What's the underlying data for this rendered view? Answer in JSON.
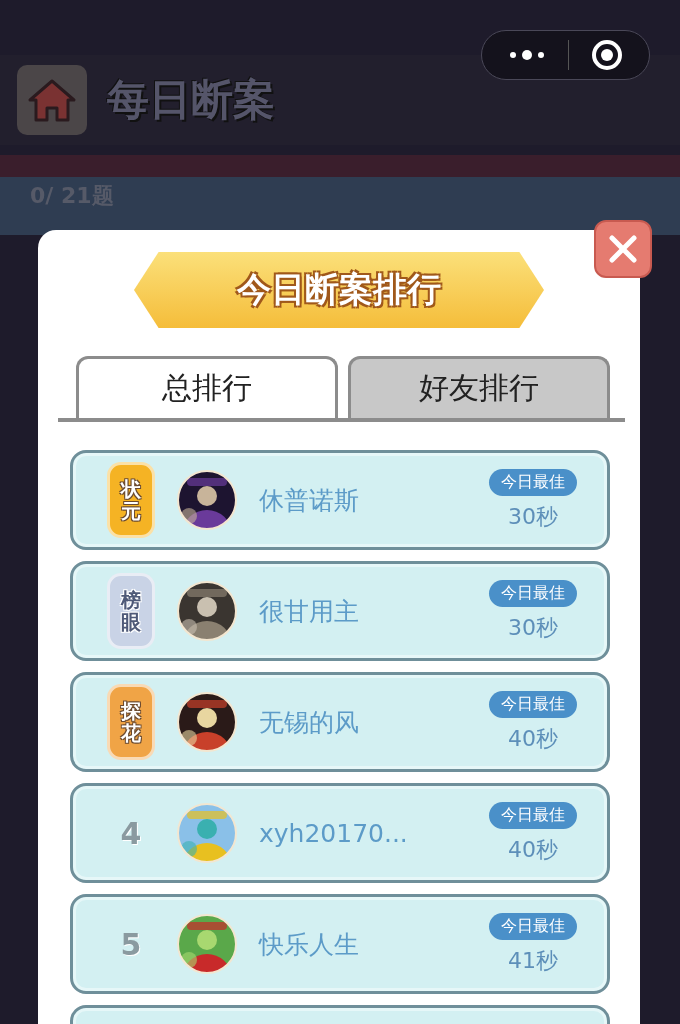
{
  "header": {
    "title": "每日断案",
    "progress": "0/ 21题"
  },
  "modal": {
    "title": "今日断案排行",
    "tabs": [
      {
        "label": "总排行",
        "selected": true
      },
      {
        "label": "好友排行",
        "selected": false
      }
    ],
    "rows": [
      {
        "kind": "medal",
        "rank": "状元",
        "color": "#f5b324",
        "name": "休普诺斯",
        "badge": "今日最佳",
        "time": "30秒"
      },
      {
        "kind": "medal",
        "rank": "榜眼",
        "color": "#c9d3e6",
        "name": "很甘用主",
        "badge": "今日最佳",
        "time": "30秒"
      },
      {
        "kind": "medal",
        "rank": "探花",
        "color": "#f0a446",
        "name": "无锡的风",
        "badge": "今日最佳",
        "time": "40秒"
      },
      {
        "kind": "number",
        "rank": "4",
        "name": "xyh20170...",
        "badge": "今日最佳",
        "time": "40秒"
      },
      {
        "kind": "number",
        "rank": "5",
        "name": "快乐人生",
        "badge": "今日最佳",
        "time": "41秒"
      }
    ]
  }
}
